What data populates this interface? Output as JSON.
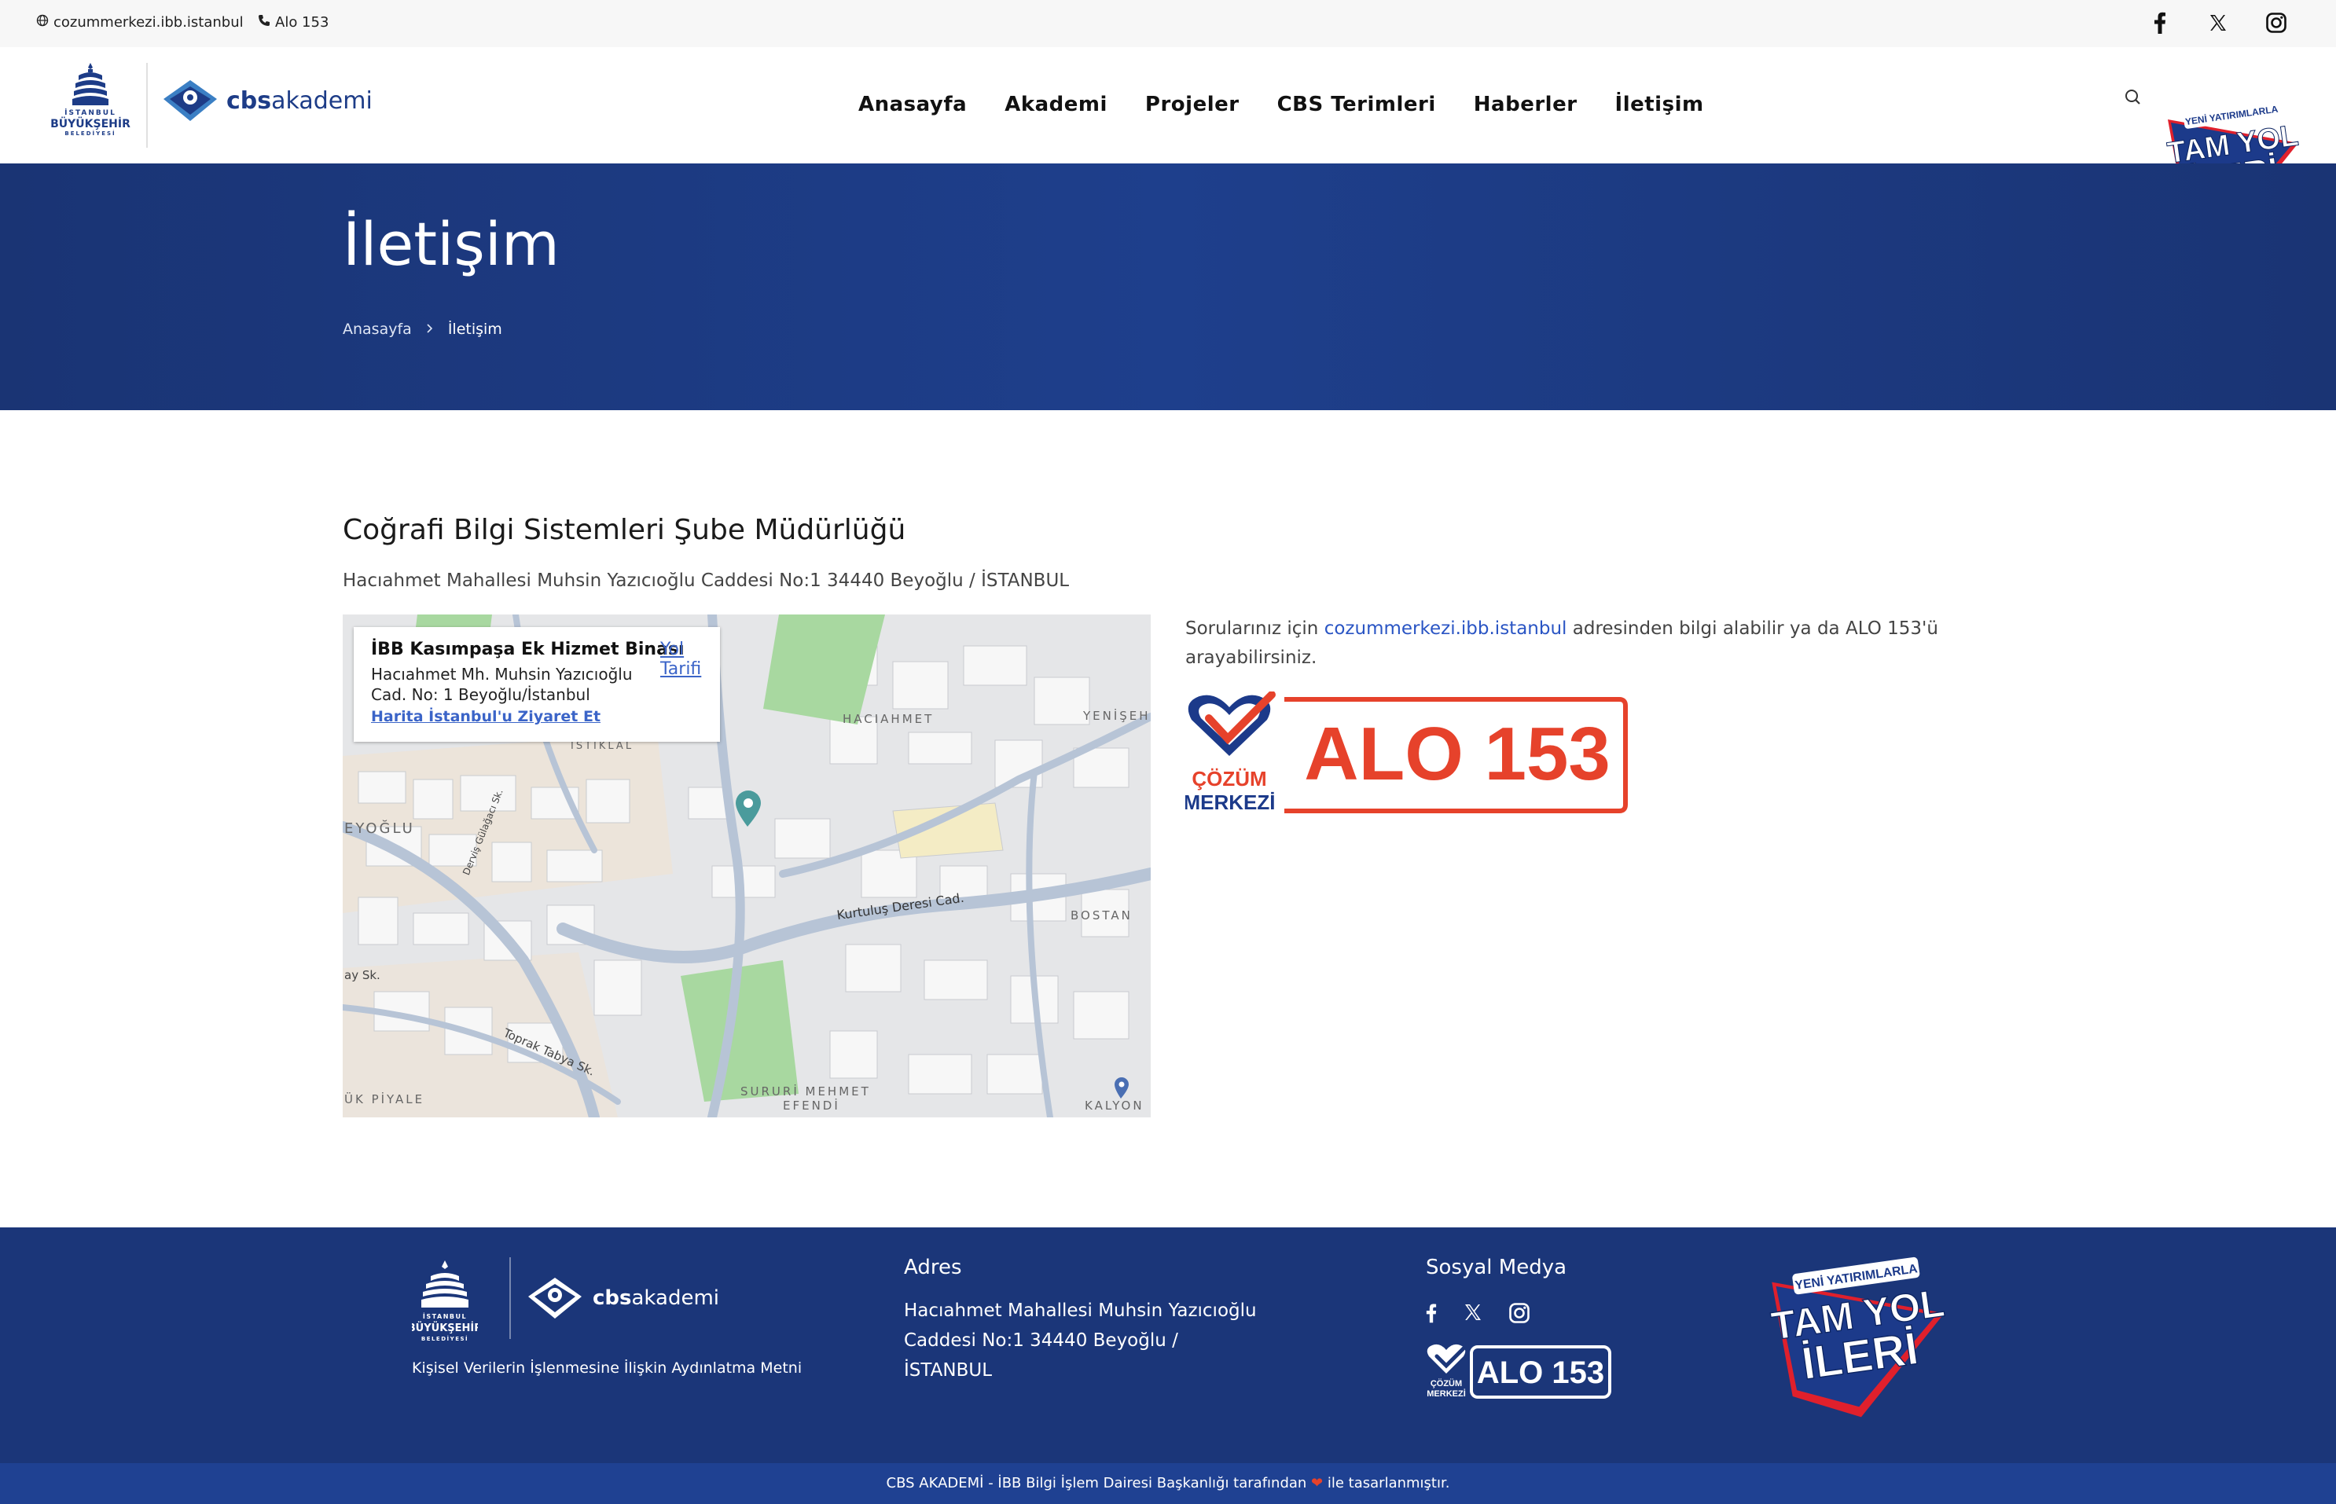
{
  "topbar": {
    "email": "cozummerkezi.ibb.istanbul",
    "phone": "Alo 153",
    "social_icons": [
      "facebook-icon",
      "x-icon",
      "instagram-icon"
    ]
  },
  "header": {
    "ibb_logo_text": [
      "İSTANBUL",
      "BÜYÜKŞEHİR",
      "BELEDİYESİ"
    ],
    "brand_bold": "cbs",
    "brand_light": "akademi",
    "nav": [
      "Anasayfa",
      "Akademi",
      "Projeler",
      "CBS Terimleri",
      "Haberler",
      "İletişim"
    ],
    "campaign": {
      "line1": "YENİ YATIRIMLARLA",
      "line2": "TAM YOL",
      "line3": "İLERİ"
    }
  },
  "hero": {
    "title": "İletişim",
    "breadcrumb": [
      "Anasayfa",
      "İletişim"
    ]
  },
  "office": {
    "title": "Coğrafi Bilgi Sistemleri Şube Müdürlüğü",
    "address": "Hacıahmet Mahallesi Muhsin Yazıcıoğlu Caddesi No:1 34440 Beyoğlu / İSTANBUL"
  },
  "map": {
    "card_title": "İBB Kasımpaşa Ek Hizmet Binası",
    "directions": "Yol Tarifi",
    "line1": "Hacıahmet Mh. Muhsin Yazıcıoğlu",
    "line2": "Cad. No: 1 Beyoğlu/İstanbul",
    "link": "Harita İstanbul'u Ziyaret Et",
    "labels": {
      "hacıahmet": "HACIAHMET",
      "yenisehir": "YENİŞEH",
      "beyoglu": "EYOĞLU",
      "bostan": "BOSTAN",
      "surur": "SURURİ MEHMET",
      "efendi": "EFENDİ",
      "piyale": "ÜK PİYALE",
      "istiklal": "İSTİKLAL",
      "kalyon": "KALYON",
      "street_kurtulus": "Kurtuluş Deresi Cad.",
      "street_toprak": "Toprak Tabya Sk.",
      "street_dervis": "Derviş Gülağacı Sk.",
      "street_sk": "ay Sk."
    }
  },
  "info": {
    "before": "Sorularınız için ",
    "link": "cozummerkezi.ibb.istanbul",
    "after": " adresinden bilgi alabilir ya da ALO 153'ü arayabilirsiniz."
  },
  "alo": {
    "cozum": "ÇÖZÜM",
    "merkezi": "MERKEZİ",
    "number": "ALO 153"
  },
  "footer": {
    "kvkk": "Kişisel Verilerin İşlenmesine İlişkin Aydınlatma Metni",
    "address_heading": "Adres",
    "address": "Hacıahmet Mahallesi Muhsin Yazıcıoğlu Caddesi No:1 34440 Beyoğlu / İSTANBUL",
    "social_heading": "Sosyal Medya",
    "copyright_pre": "CBS AKADEMİ - İBB Bilgi İşlem Dairesi Başkanlığı tarafından",
    "copyright_post": "ile tasarlanmıştır."
  },
  "colors": {
    "navy": "#1b3679",
    "hero": "#1e3f8c",
    "red": "#e6422b",
    "link": "#2a55c4"
  }
}
